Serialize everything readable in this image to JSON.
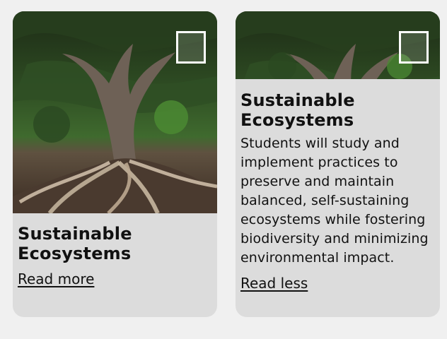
{
  "cards": [
    {
      "title": "Sustainable Ecosystems",
      "link_label": "Read more",
      "image_icon": "tree-photo"
    },
    {
      "title": "Sustainable Ecosystems",
      "description": "Students will study and implement practices to preserve and maintain balanced, self-sustaining ecosystems while fostering biodiversity and minimizing environmental impact.",
      "link_label": "Read less",
      "image_icon": "tree-photo"
    }
  ],
  "colors": {
    "page_bg": "#f0f0f0",
    "card_bg": "#dcdcdc",
    "text": "#111111"
  }
}
